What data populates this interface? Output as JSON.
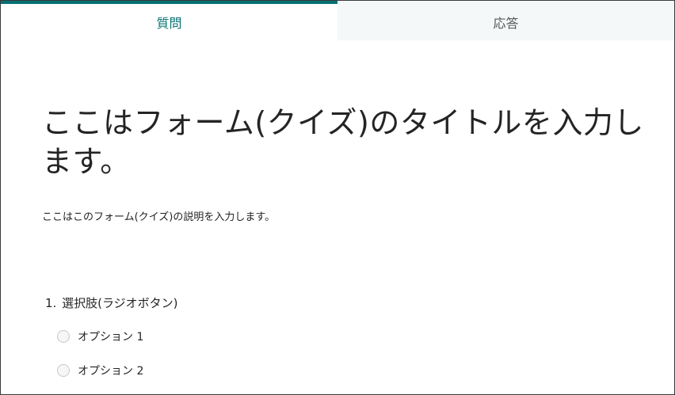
{
  "tabs": [
    {
      "label": "質問",
      "active": true
    },
    {
      "label": "応答",
      "active": false
    }
  ],
  "form": {
    "title": "ここはフォーム(クイズ)のタイトルを入力します。",
    "description": "ここはこのフォーム(クイズ)の説明を入力します。"
  },
  "question": {
    "number": "1.",
    "title": "選択肢(ラジオボタン)",
    "options": [
      "オプション 1",
      "オプション 2"
    ]
  },
  "colors": {
    "accent": "#077173",
    "tab_inactive_bg": "#f4f8f8",
    "text": "#252424"
  }
}
